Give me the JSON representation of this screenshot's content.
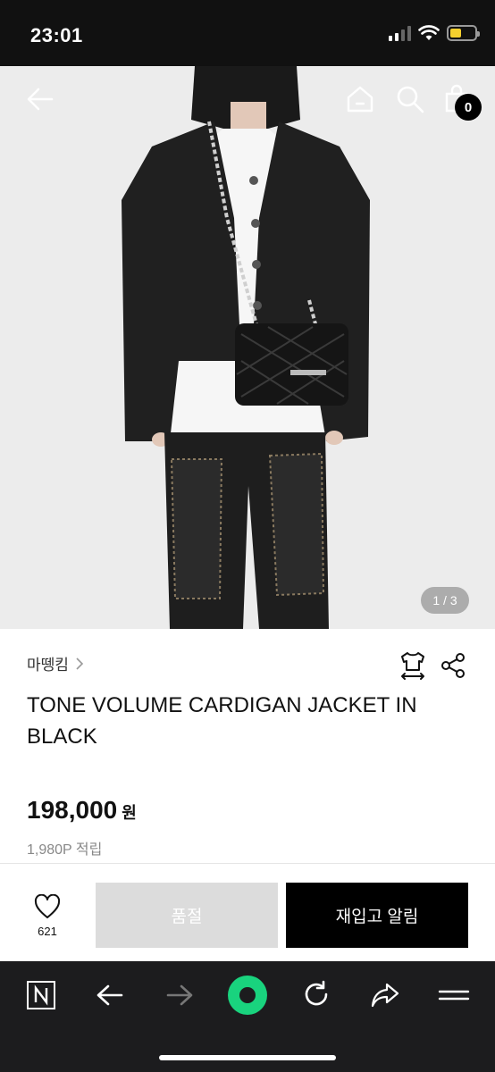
{
  "status_bar": {
    "time": "23:01"
  },
  "hero": {
    "page_indicator": "1 / 3",
    "cart_count": "0"
  },
  "product": {
    "brand": "마뗑킴",
    "title": "TONE VOLUME CARDIGAN JACKET IN BLACK",
    "price": "198,000",
    "currency": "원",
    "points": "1,980P 적립"
  },
  "actions": {
    "like_count": "621",
    "soldout_label": "품절",
    "restock_label": "재입고 알림"
  },
  "colors": {
    "status_bar_bg": "#111111",
    "soldout_bg": "#dcdcdc",
    "restock_bg": "#000000",
    "browser_bar_bg": "#1c1c1e",
    "record_button": "#19d37e",
    "battery": "#f5d02e"
  }
}
